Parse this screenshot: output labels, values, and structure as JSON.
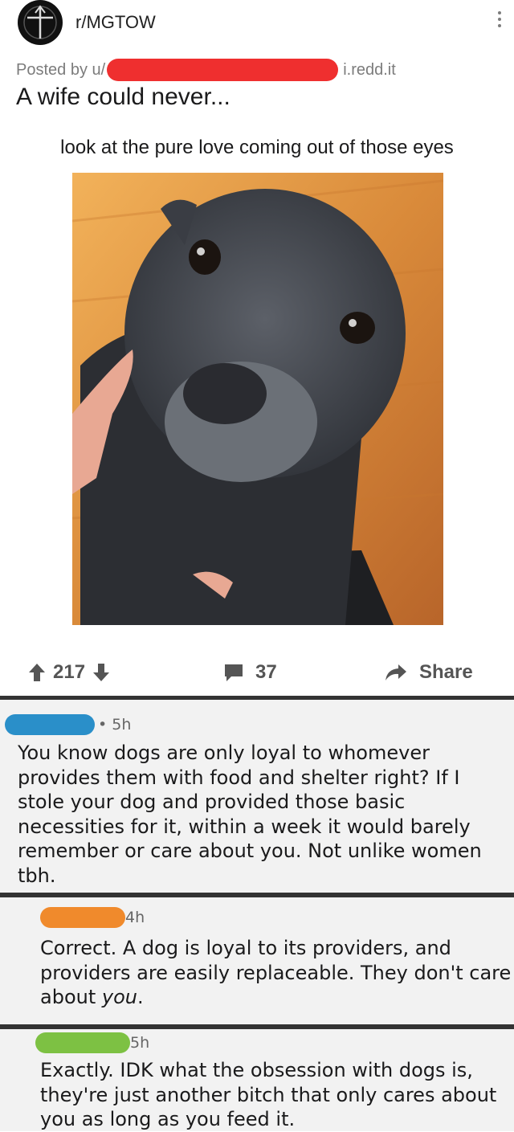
{
  "post": {
    "subreddit": "r/MGTOW",
    "posted_by_prefix": "Posted by u/",
    "domain": "i.redd.it",
    "title": "A wife could never...",
    "caption": "look at the pure love coming out of those eyes",
    "upvotes": "217",
    "comments": "37",
    "share_label": "Share"
  },
  "comments": [
    {
      "age": "• 5h",
      "redaction_color": "#2a8fc9",
      "body": "You know dogs are only loyal to whomever\nprovides them with food and shelter right? If I\nstole your dog and provided those basic\nnecessities for it, within a week it would barely\nremember or care about you. Not unlike women\ntbh."
    },
    {
      "age": "4h",
      "redaction_color": "#f08a2c",
      "body_plain": "Correct. A dog is loyal to its providers, and\nproviders are easily replaceable. They don't care\nabout ",
      "body_italic": "you",
      "body_tail": "."
    },
    {
      "age": "5h",
      "redaction_color": "#7dc143",
      "body": "Exactly. IDK what the obsession with dogs is,\nthey're just another bitch that only cares about\nyou as long as you feed it."
    }
  ],
  "colors": {
    "redaction_red": "#ef2f2f",
    "divider": "#333333",
    "comment_bg": "#f2f2f2"
  },
  "icons": [
    "subreddit-avatar-icon",
    "kebab-menu-icon",
    "upvote-arrow-icon",
    "downvote-arrow-icon",
    "comment-bubble-icon",
    "share-arrow-icon"
  ]
}
